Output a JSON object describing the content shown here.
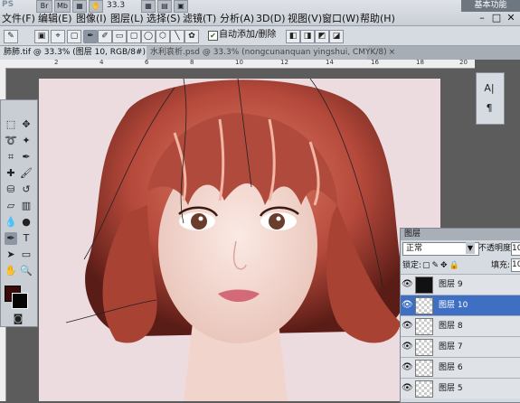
{
  "app": {
    "logo": "PS",
    "workspace_button": "基本功能",
    "zoom": "33.3",
    "icons": [
      "Br",
      "Mb"
    ],
    "window_controls": [
      "–",
      "□",
      "✕"
    ]
  },
  "menu": [
    "文件(F)",
    "编辑(E)",
    "图像(I)",
    "图层(L)",
    "选择(S)",
    "滤镜(T)",
    "分析(A)",
    "3D(D)",
    "视图(V)",
    "窗口(W)",
    "帮助(H)"
  ],
  "options_bar": {
    "auto_add_delete_checked": true,
    "auto_add_delete_label": "自动添加/删除"
  },
  "tabs": [
    {
      "label": "肺肺.tif @ 33.3% (图层 10, RGB/8#) *",
      "active": true
    },
    {
      "label": "水利哀析.psd @ 33.3% (nongcunanquan yingshui, CMYK/8)",
      "active": false
    }
  ],
  "ruler": [
    "2",
    "4",
    "6",
    "8",
    "10",
    "12",
    "14",
    "16",
    "18",
    "20"
  ],
  "layers_panel": {
    "title": "图层",
    "blend_mode": "正常",
    "opacity_label": "不透明度:",
    "opacity_value": "10",
    "lock_label": "锁定:",
    "fill_label": "填充:",
    "fill_value": "10",
    "layers": [
      {
        "name": "图层 9",
        "selected": false,
        "thumb": "dark"
      },
      {
        "name": "图层 10",
        "selected": true,
        "thumb": "transparent"
      },
      {
        "name": "图层 8",
        "selected": false,
        "thumb": "transparent"
      },
      {
        "name": "图层 7",
        "selected": false,
        "thumb": "transparent"
      },
      {
        "name": "图层 6",
        "selected": false,
        "thumb": "transparent"
      },
      {
        "name": "图层 5",
        "selected": false,
        "thumb": "transparent"
      }
    ]
  },
  "colors": {
    "foreground": "#3a0a0a",
    "background": "#050505",
    "selected_layer": "#3e6fc2",
    "hair": "#b5493b"
  }
}
